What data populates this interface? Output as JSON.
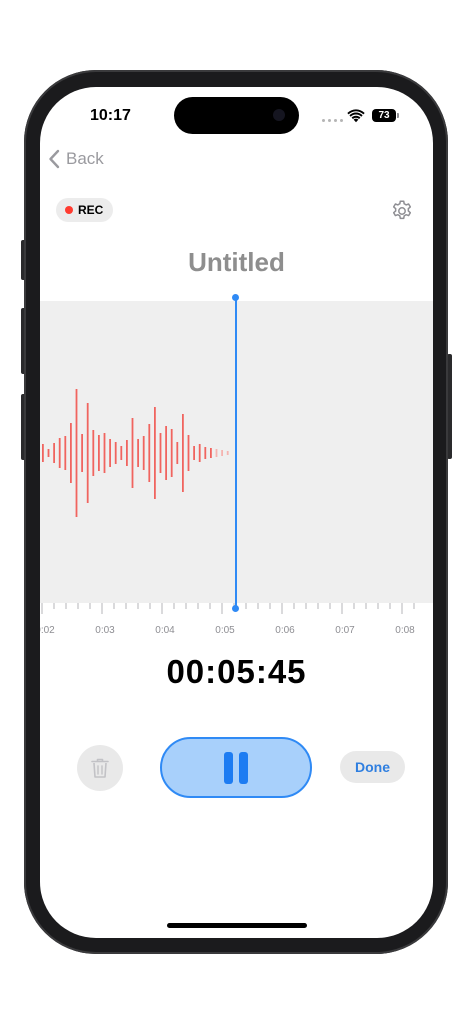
{
  "status_bar": {
    "time": "10:17",
    "battery": "73"
  },
  "nav": {
    "back_label": "Back"
  },
  "recording_badge": {
    "label": "REC"
  },
  "recording": {
    "title": "Untitled",
    "elapsed": "00:05:45"
  },
  "timeline": {
    "labels": [
      "0:02",
      "0:03",
      "0:04",
      "0:05",
      "0:06",
      "0:07",
      "0:08"
    ]
  },
  "controls": {
    "done_label": "Done"
  },
  "icons": {
    "back": "chevron-left-icon",
    "settings": "gear-icon",
    "delete": "trash-icon",
    "pause": "pause-icon"
  },
  "colors": {
    "accent": "#2f8af5",
    "record": "#ff3b30",
    "waveform": "#f0645f",
    "waveform_bg": "#efefef"
  }
}
